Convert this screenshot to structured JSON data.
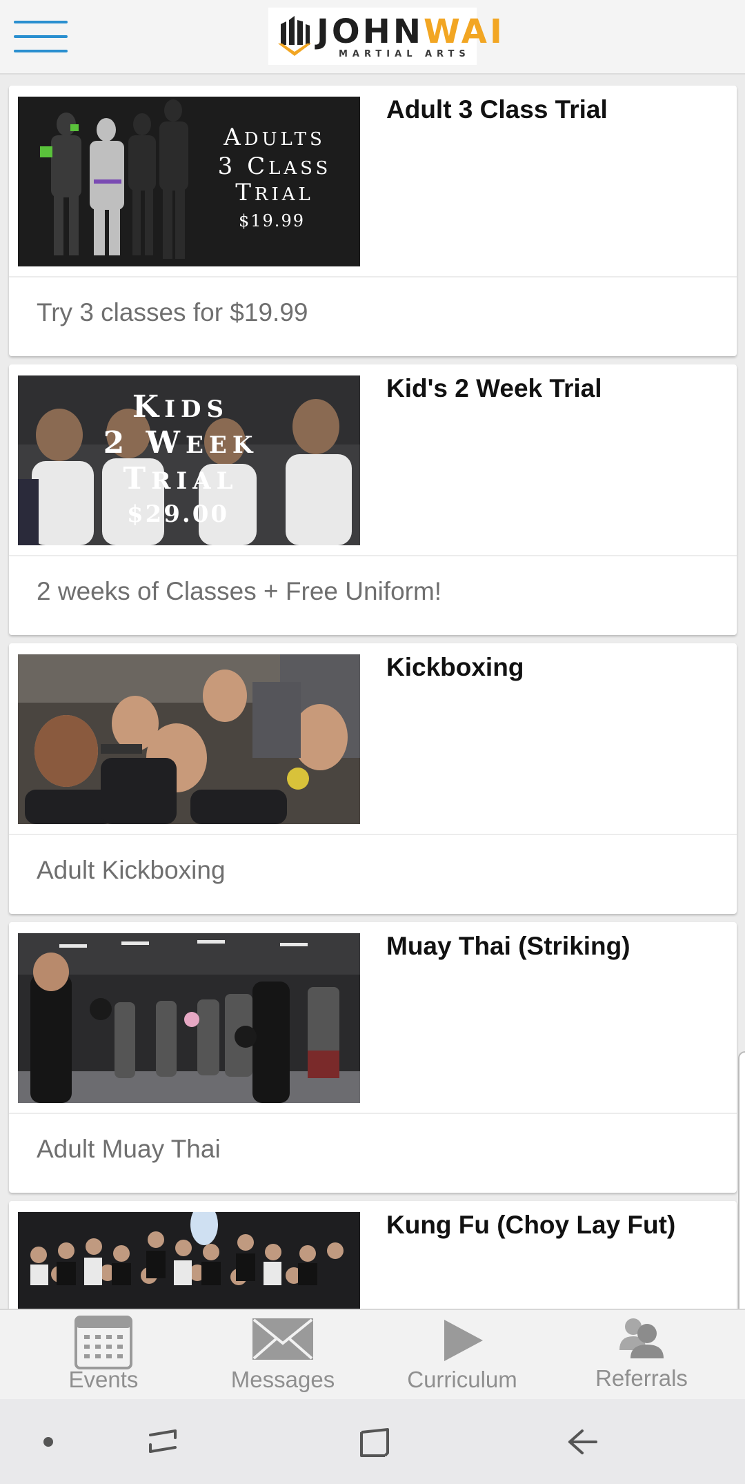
{
  "header": {
    "menu_icon": "hamburger-menu-icon",
    "logo": {
      "name": "JOHNWAI",
      "name_part1": "JOHN",
      "name_part2": "WAI",
      "tagline": "MARTIAL ARTS",
      "accent": "#f2a623"
    }
  },
  "programs": [
    {
      "title": "Adult 3 Class Trial",
      "description": "Try 3 classes for $19.99",
      "image": {
        "type": "promo",
        "lines": [
          "ADULTS",
          "3 CLASS",
          "TRIAL"
        ],
        "price": "$19.99"
      }
    },
    {
      "title": "Kid's 2 Week Trial",
      "description": "2 weeks of Classes + Free Uniform!",
      "image": {
        "type": "promo",
        "lines": [
          "KIDS",
          "2 WEEK",
          "TRIAL"
        ],
        "price": "$29.00"
      }
    },
    {
      "title": "Kickboxing",
      "description": "Adult Kickboxing",
      "image": {
        "type": "photo",
        "subject": "group selfie"
      }
    },
    {
      "title": "Muay Thai (Striking)",
      "description": "Adult Muay Thai",
      "image": {
        "type": "photo",
        "subject": "boxing class in gym"
      }
    },
    {
      "title": "Kung Fu (Choy Lay Fut)",
      "description": "",
      "image": {
        "type": "photo",
        "subject": "large group photo"
      }
    }
  ],
  "tabs": [
    {
      "label": "Events",
      "icon": "calendar-icon"
    },
    {
      "label": "Messages",
      "icon": "envelope-icon"
    },
    {
      "label": "Curriculum",
      "icon": "play-icon"
    },
    {
      "label": "Referrals",
      "icon": "people-icon"
    }
  ],
  "colors": {
    "accent_blue": "#2a8fcf",
    "tab_icon": "#9a9a9a"
  },
  "system_nav": [
    "dot-icon",
    "recent-apps-icon",
    "home-icon",
    "back-icon"
  ]
}
